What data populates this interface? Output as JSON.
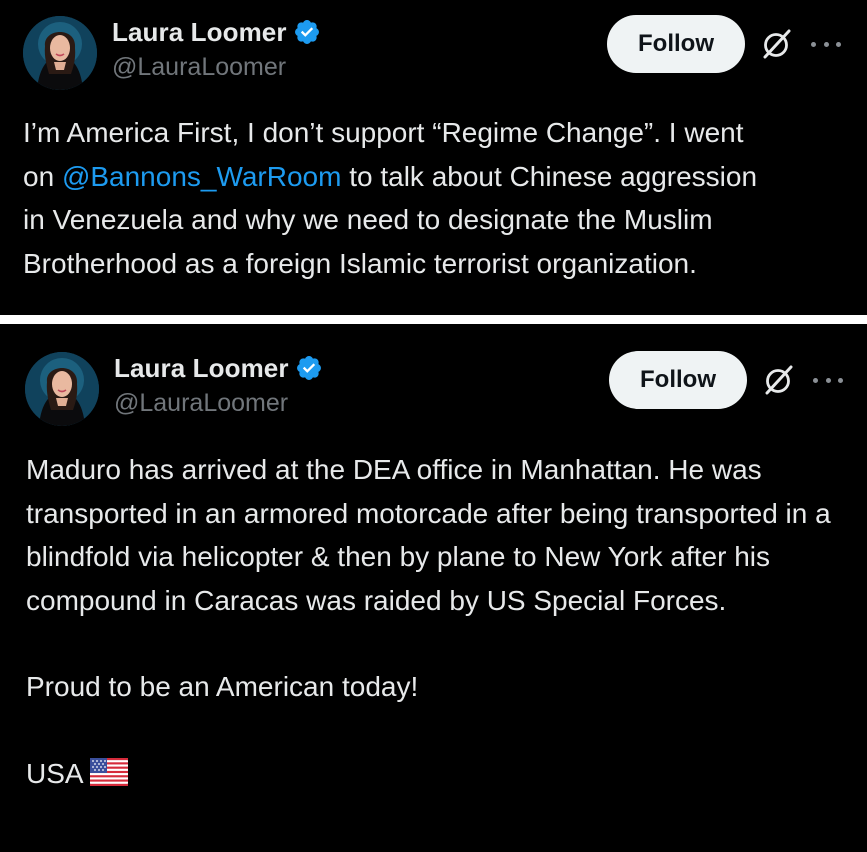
{
  "tweets": [
    {
      "author": {
        "display_name": "Laura Loomer",
        "handle": "@LauraLoomer",
        "verified": true
      },
      "follow_label": "Follow",
      "text_lines": {
        "line1": "I’m America First, I don’t support “Regime Change”. I went",
        "line2_prefix": "on ",
        "mention": "@Bannons_WarRoom",
        "line2_suffix": " to talk about Chinese aggression",
        "line3": "in Venezuela and why we need to designate the Muslim",
        "line4": "Brotherhood as a foreign Islamic terrorist organization."
      }
    },
    {
      "author": {
        "display_name": "Laura Loomer",
        "handle": "@LauraLoomer",
        "verified": true
      },
      "follow_label": "Follow",
      "paragraphs": {
        "p1": "Maduro has arrived at the DEA office in Manhattan. He was transported in an armored motorcade after being transported in a blindfold via helicopter & then by plane to New York after his compound in Caracas was raided by US Special Forces.",
        "p2": "Proud to be an American today!",
        "p3": "USA"
      }
    }
  ],
  "icons": {
    "verified": "verified-badge-icon",
    "grok": "grok-icon",
    "more": "more-options-icon",
    "flag": "us-flag-icon"
  },
  "colors": {
    "background": "#000000",
    "text": "#e7e9ea",
    "secondary_text": "#71767b",
    "link": "#1d9bf0",
    "verified": "#1d9bf0",
    "follow_bg": "#eff3f4",
    "follow_text": "#0f1419"
  }
}
